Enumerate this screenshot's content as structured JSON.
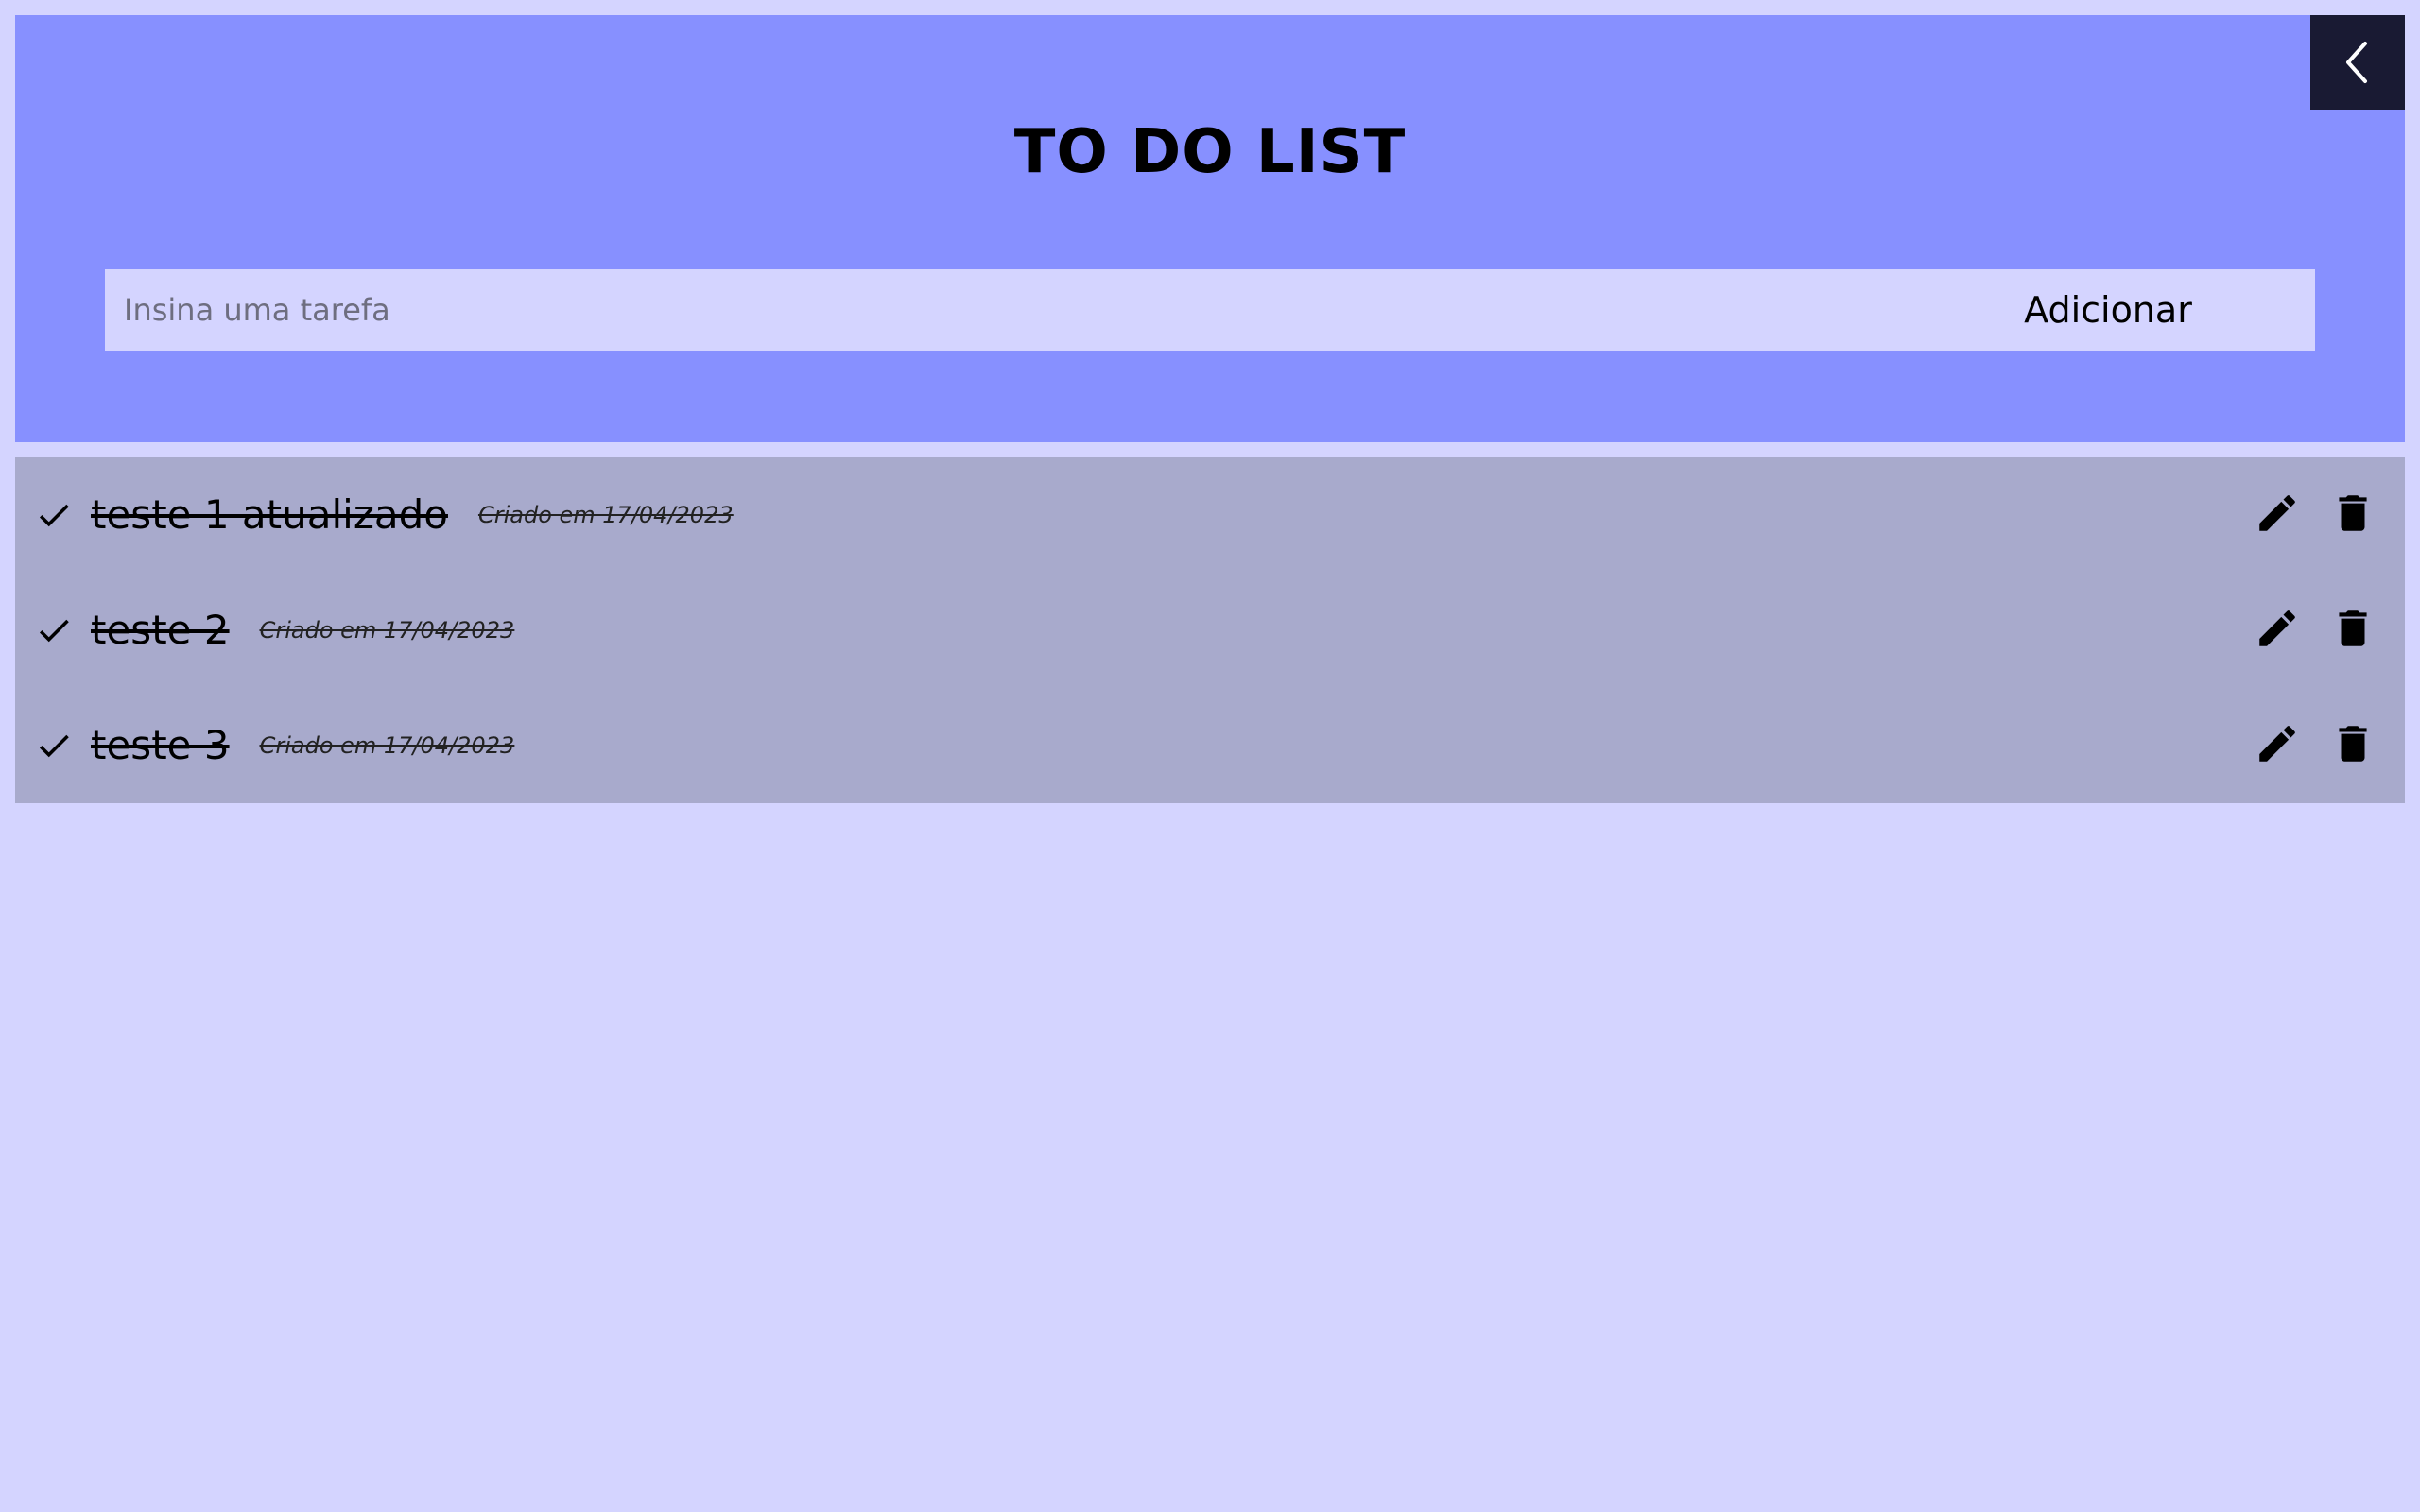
{
  "header": {
    "title": "TO DO LIST",
    "back_icon": "chevron-left-icon",
    "background_color": "#8790ff"
  },
  "form": {
    "placeholder": "Insina uma tarefa",
    "value": "",
    "add_label": "Adicionar"
  },
  "tasks": [
    {
      "text": "teste 1 atualizado",
      "created": "Criado em 17/04/2023",
      "completed": true
    },
    {
      "text": "teste 2",
      "created": "Criado em 17/04/2023",
      "completed": true
    },
    {
      "text": "teste 3",
      "created": "Criado em 17/04/2023",
      "completed": true
    }
  ],
  "icons": {
    "complete": "check-icon",
    "edit": "pencil-icon",
    "delete": "trash-icon"
  },
  "colors": {
    "page_background": "#d4d4ff",
    "list_background": "#a8aacc",
    "back_button": "#191a33"
  }
}
